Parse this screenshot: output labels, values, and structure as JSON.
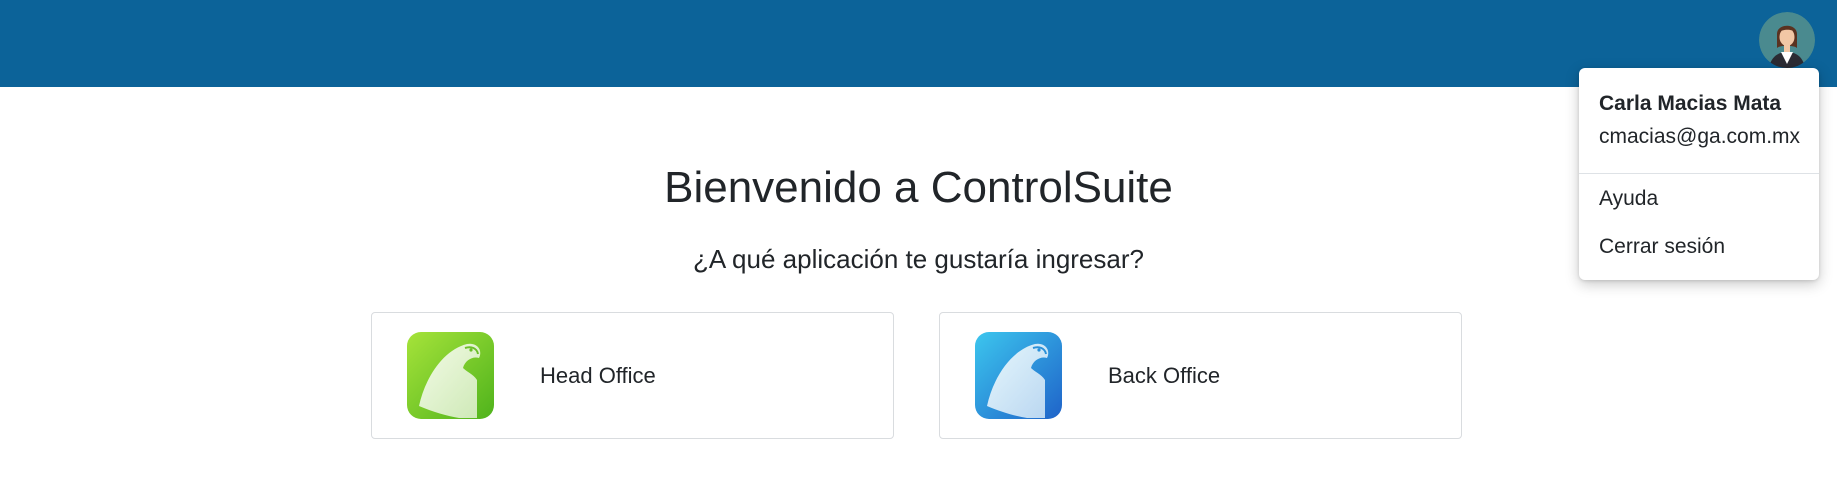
{
  "header": {
    "background_color": "#0c6399",
    "avatar_icon": "user-avatar-woman"
  },
  "welcome": {
    "title": "Bienvenido a ControlSuite",
    "subtitle": "¿A qué aplicación te gustaría ingresar?"
  },
  "apps": [
    {
      "label": "Head Office",
      "icon": "head-office-logo-icon",
      "color": "#7bcc2a"
    },
    {
      "label": "Back Office",
      "icon": "back-office-logo-icon",
      "color": "#2a9ee0"
    }
  ],
  "user_menu": {
    "name": "Carla Macias Mata",
    "email": "cmacias@ga.com.mx",
    "items": [
      {
        "label": "Ayuda"
      },
      {
        "label": "Cerrar sesión"
      }
    ]
  }
}
